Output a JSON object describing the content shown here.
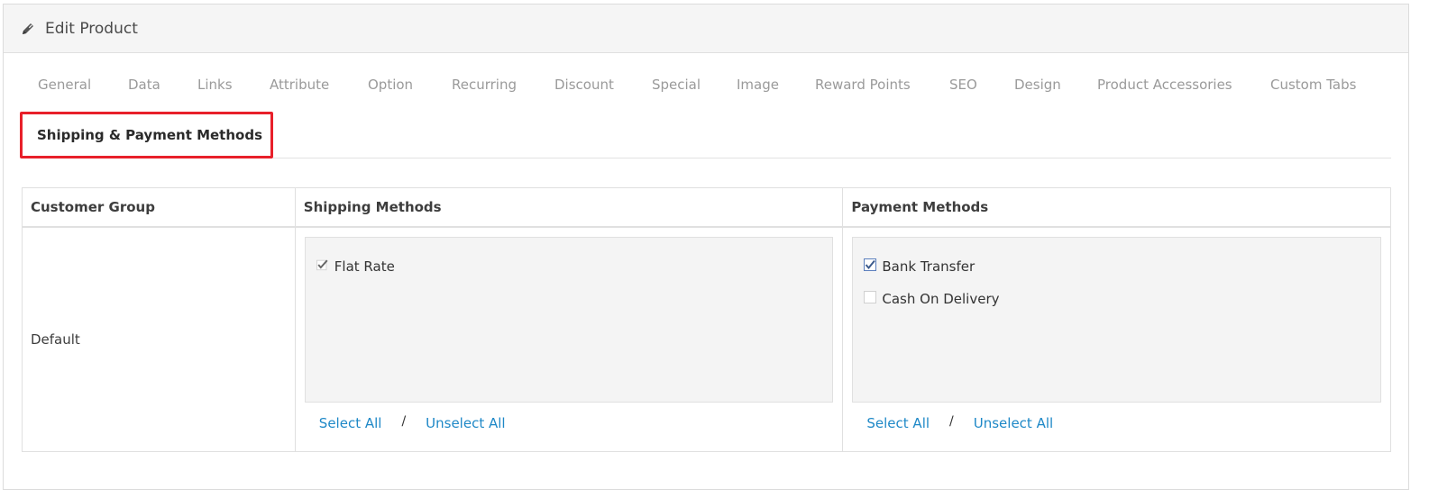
{
  "panel": {
    "title": "Edit Product",
    "icon": "pencil-icon"
  },
  "tabs": [
    {
      "label": "General"
    },
    {
      "label": "Data"
    },
    {
      "label": "Links"
    },
    {
      "label": "Attribute"
    },
    {
      "label": "Option"
    },
    {
      "label": "Recurring"
    },
    {
      "label": "Discount"
    },
    {
      "label": "Special"
    },
    {
      "label": "Image"
    },
    {
      "label": "Reward Points"
    },
    {
      "label": "SEO"
    },
    {
      "label": "Design"
    },
    {
      "label": "Product Accessories"
    },
    {
      "label": "Custom Tabs"
    }
  ],
  "active_tab": {
    "label": "Shipping & Payment Methods"
  },
  "table": {
    "headers": {
      "customer_group": "Customer Group",
      "shipping": "Shipping Methods",
      "payment": "Payment Methods"
    },
    "rows": [
      {
        "customer_group": "Default",
        "shipping_methods": [
          {
            "label": "Flat Rate",
            "checked": true
          }
        ],
        "payment_methods": [
          {
            "label": "Bank Transfer",
            "checked": true
          },
          {
            "label": "Cash On Delivery",
            "checked": false
          }
        ]
      }
    ]
  },
  "links": {
    "select_all": "Select All",
    "separator": "/",
    "unselect_all": "Unselect All"
  },
  "colors": {
    "active_tab_border": "#e8202a",
    "link": "#1e88c7",
    "tab_text": "#9a9a9a"
  }
}
